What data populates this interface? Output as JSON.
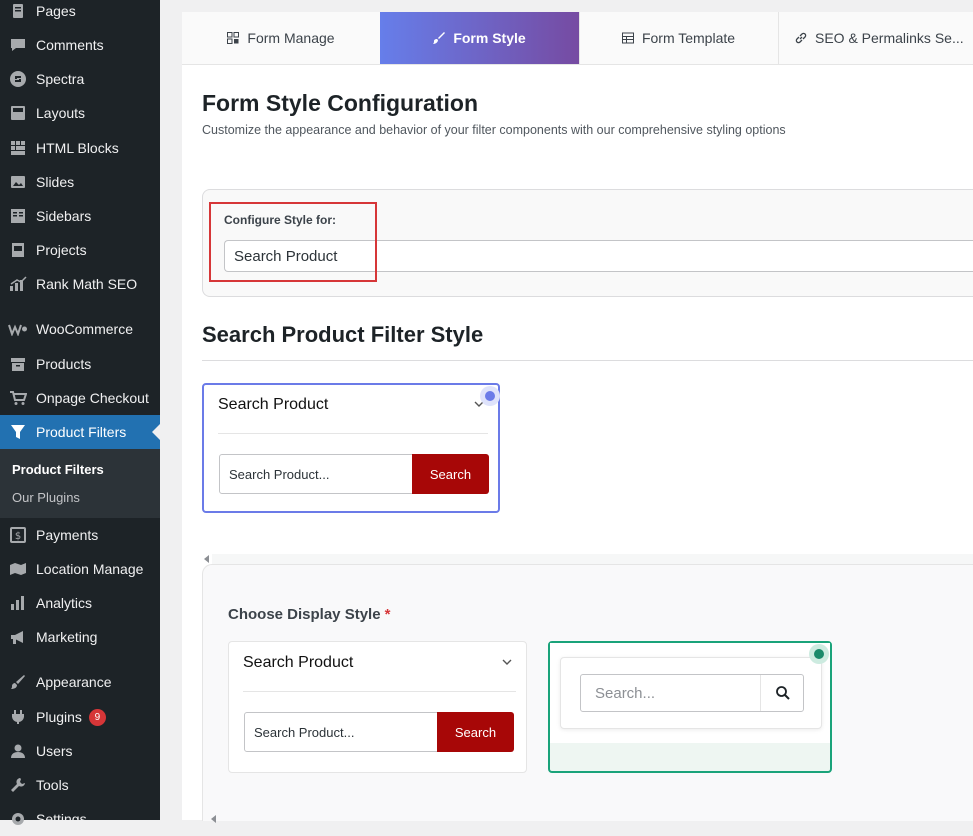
{
  "sidebar": {
    "items": [
      {
        "label": "Pages",
        "icon": "pages-icon"
      },
      {
        "label": "Comments",
        "icon": "comments-icon"
      },
      {
        "label": "Spectra",
        "icon": "spectra-icon"
      },
      {
        "label": "Layouts",
        "icon": "layouts-icon"
      },
      {
        "label": "HTML Blocks",
        "icon": "html-blocks-icon"
      },
      {
        "label": "Slides",
        "icon": "slides-icon"
      },
      {
        "label": "Sidebars",
        "icon": "sidebars-icon"
      },
      {
        "label": "Projects",
        "icon": "projects-icon"
      },
      {
        "label": "Rank Math SEO",
        "icon": "rank-math-icon"
      },
      {
        "label": "WooCommerce",
        "icon": "woocommerce-icon"
      },
      {
        "label": "Products",
        "icon": "products-icon"
      },
      {
        "label": "Onpage Checkout",
        "icon": "cart-icon"
      },
      {
        "label": "Product Filters",
        "icon": "filter-icon"
      },
      {
        "label": "Payments",
        "icon": "payments-icon"
      },
      {
        "label": "Location Manage",
        "icon": "location-icon"
      },
      {
        "label": "Analytics",
        "icon": "analytics-icon"
      },
      {
        "label": "Marketing",
        "icon": "marketing-icon"
      },
      {
        "label": "Appearance",
        "icon": "appearance-icon"
      },
      {
        "label": "Plugins",
        "icon": "plugins-icon",
        "badge": "9"
      },
      {
        "label": "Users",
        "icon": "users-icon"
      },
      {
        "label": "Tools",
        "icon": "tools-icon"
      },
      {
        "label": "Settings",
        "icon": "settings-icon"
      }
    ],
    "submenu": [
      "Product Filters",
      "Our Plugins"
    ]
  },
  "tabs": [
    {
      "label": "Form Manage",
      "icon": "grid-icon"
    },
    {
      "label": "Form Style",
      "icon": "brush-icon"
    },
    {
      "label": "Form Template",
      "icon": "table-icon"
    },
    {
      "label": "SEO & Permalinks Se...",
      "icon": "link-icon"
    }
  ],
  "page": {
    "title": "Form Style Configuration",
    "description": "Customize the appearance and behavior of your filter components with our comprehensive styling options"
  },
  "config": {
    "label": "Configure Style for:",
    "selected": "Search Product"
  },
  "section": {
    "title": "Search Product Filter Style"
  },
  "preview": {
    "heading": "Search Product",
    "input_placeholder": "Search Product...",
    "button": "Search"
  },
  "display_style": {
    "label": "Choose Display Style",
    "required": "*",
    "option1": {
      "heading": "Search Product",
      "input_placeholder": "Search Product...",
      "button": "Search"
    },
    "option2": {
      "input_placeholder": "Search..."
    }
  },
  "colors": {
    "accent_gradient_start": "#667eea",
    "accent_gradient_end": "#764ba2",
    "wp_blue": "#2271b1",
    "search_red": "#a70707",
    "teal": "#1aa37a"
  }
}
